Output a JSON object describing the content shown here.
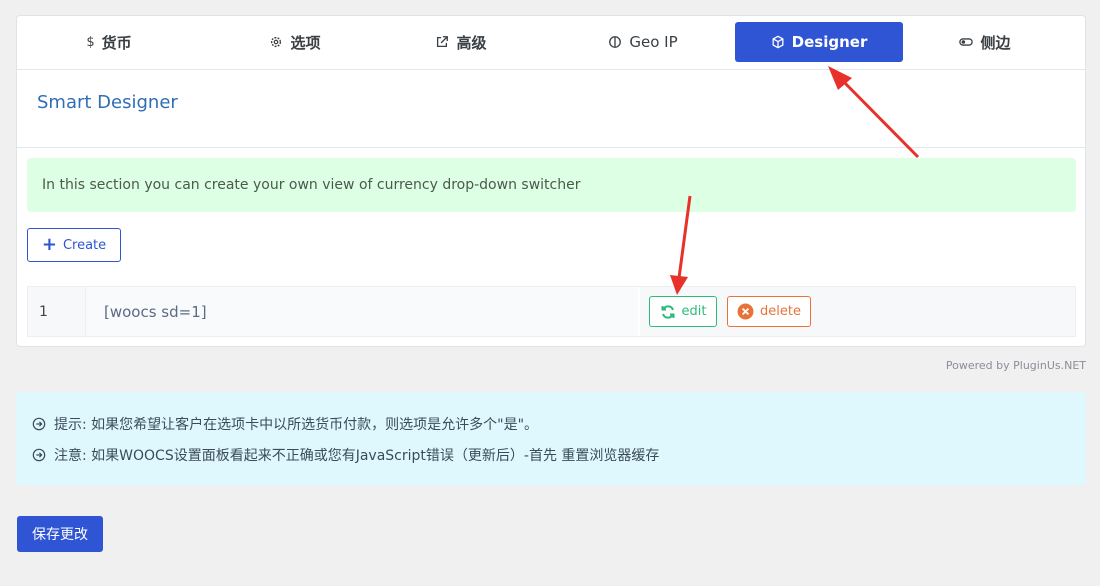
{
  "tabs": [
    {
      "label": "货币",
      "icon": "dollar-icon",
      "glyph": "$"
    },
    {
      "label": "选项",
      "icon": "gear-icon"
    },
    {
      "label": "高级",
      "icon": "external-link-icon"
    },
    {
      "label": "Geo IP",
      "icon": "half-circle-icon"
    },
    {
      "label": "Designer",
      "icon": "cube-icon",
      "active": true
    },
    {
      "label": "侧边",
      "icon": "toggle-icon"
    }
  ],
  "section": {
    "title": "Smart Designer",
    "notice": "In this section you can create your own view of currency drop-down switcher",
    "create_label": "Create"
  },
  "table": {
    "rows": [
      {
        "num": "1",
        "shortcode": "[woocs sd=1]",
        "edit_label": "edit",
        "delete_label": "delete"
      }
    ]
  },
  "powered_by": "Powered by PluginUs.NET",
  "info": {
    "lines": [
      "提示: 如果您希望让客户在选项卡中以所选货币付款，则选项是允许多个\"是\"。",
      "注意: 如果WOOCS设置面板看起来不正确或您有JavaScript错误（更新后）-首先 重置浏览器缓存"
    ]
  },
  "save_label": "保存更改",
  "colors": {
    "accent": "#2f55d4",
    "edit": "#2dbb7a",
    "delete": "#e8733a",
    "notice_bg": "#ddffe4",
    "info_bg": "#dff8fd",
    "arrow": "#e8312a",
    "title": "#2f6db5"
  }
}
